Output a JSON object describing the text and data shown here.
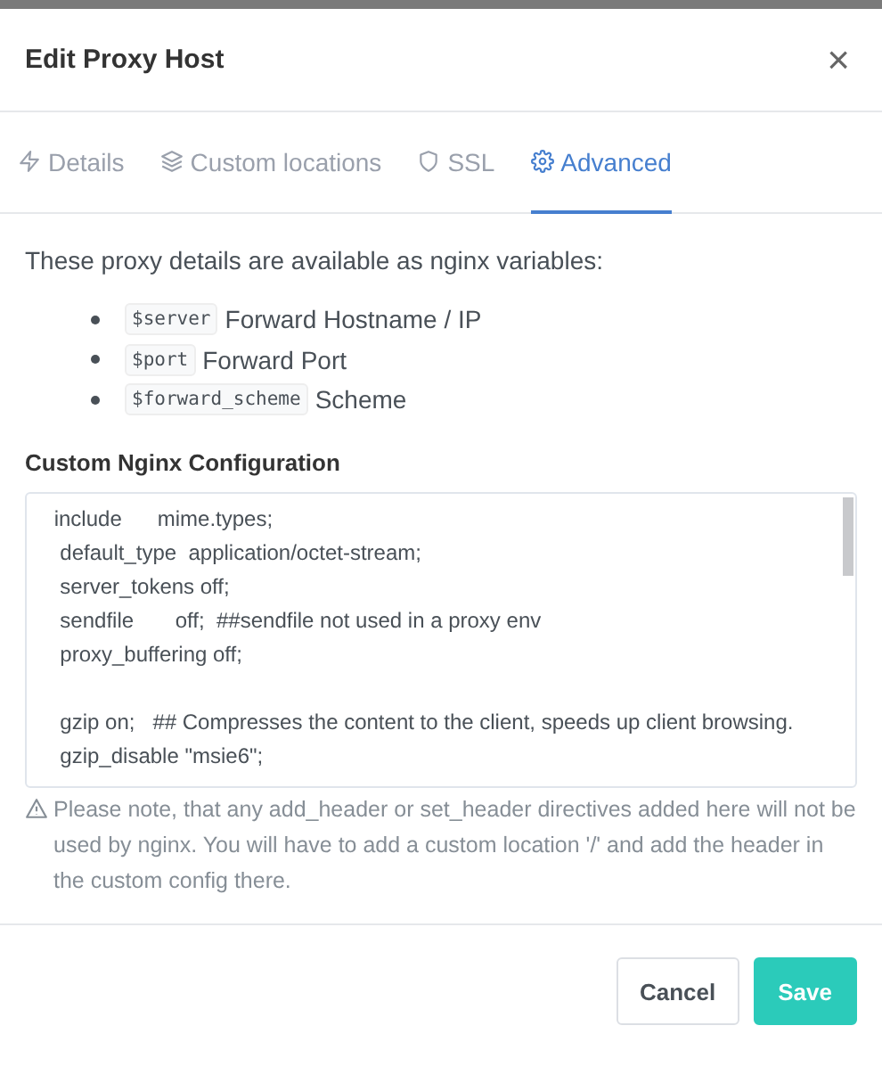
{
  "modal": {
    "title": "Edit Proxy Host",
    "close": "×"
  },
  "tabs": [
    {
      "label": "Details",
      "selected": false
    },
    {
      "label": "Custom locations",
      "selected": false
    },
    {
      "label": "SSL",
      "selected": false
    },
    {
      "label": "Advanced",
      "selected": true
    }
  ],
  "intro": "These proxy details are available as nginx variables:",
  "variables": [
    {
      "code": "$server",
      "text": "Forward Hostname / IP"
    },
    {
      "code": "$port",
      "text": "Forward Port"
    },
    {
      "code": "$forward_scheme",
      "text": "Scheme"
    }
  ],
  "config": {
    "label": "Custom Nginx Configuration",
    "value": " include      mime.types;\n  default_type  application/octet-stream;\n  server_tokens off;\n  sendfile       off;  ##sendfile not used in a proxy env\n  proxy_buffering off;\n\n  gzip on;   ## Compresses the content to the client, speeds up client browsing.\n  gzip_disable \"msie6\";",
    "note": "Please note, that any add_header or set_header directives added here will not be used by nginx. You will have to add a custom location '/' and add the header in the custom config there."
  },
  "buttons": [
    {
      "label": "Cancel",
      "kind": "secondary"
    },
    {
      "label": "Save",
      "kind": "primary"
    }
  ]
}
